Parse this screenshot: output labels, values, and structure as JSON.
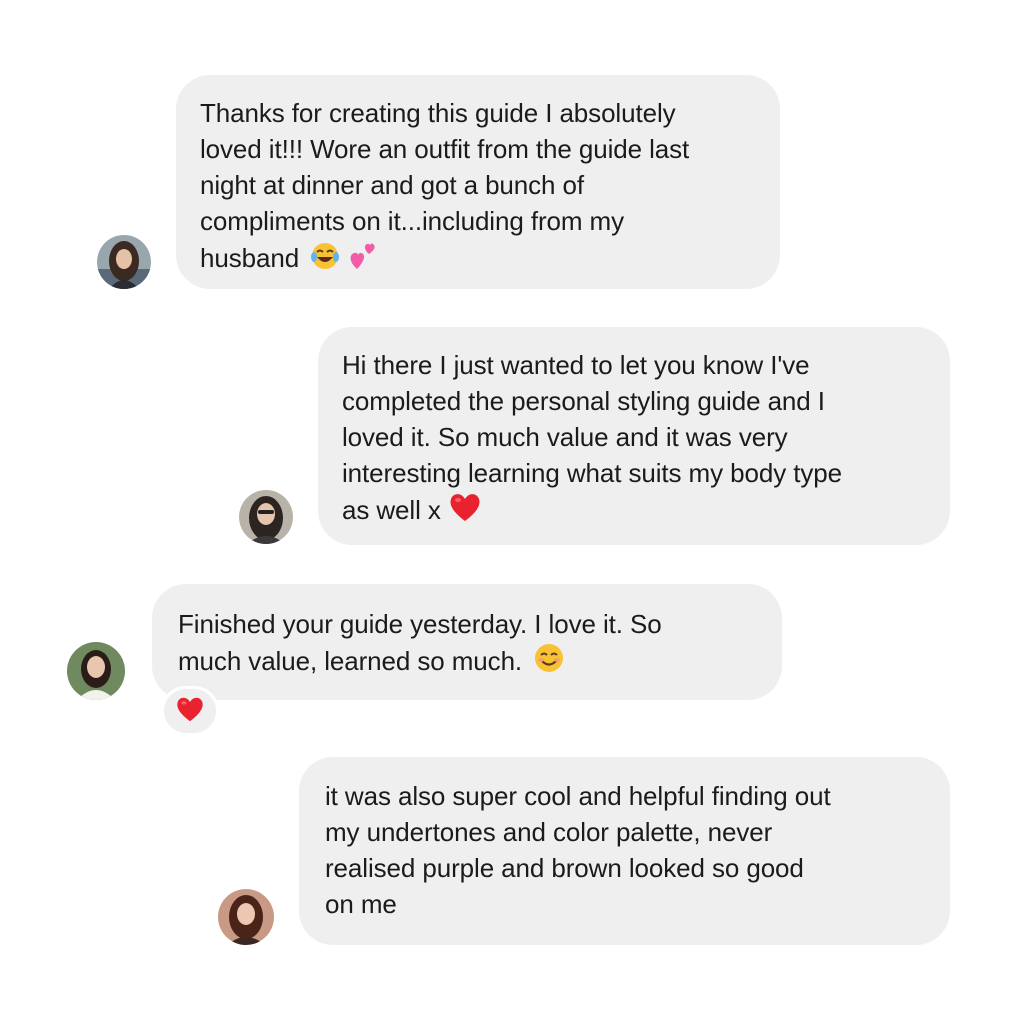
{
  "messages": [
    {
      "text": "Thanks for creating this guide I absolutely\nloved it!!! Wore an outfit from the guide last\nnight at dinner and got a bunch of\ncompliments on it...including from my\nhusband",
      "emoji": [
        "laughing-tears-emoji",
        "two-hearts-emoji"
      ]
    },
    {
      "text": "Hi there I just wanted to let you know I've\ncompleted the personal styling guide and I\nloved it. So much value and it was very\ninteresting learning what suits my body type\nas well x",
      "emoji": [
        "red-heart-emoji"
      ]
    },
    {
      "text": "Finished your guide yesterday. I love it. So\nmuch value, learned so much.",
      "emoji": [
        "smiling-face-emoji"
      ],
      "reaction": "red-heart-emoji"
    },
    {
      "text": "it was also super cool and helpful finding out\nmy undertones and color palette, never\nrealised purple and brown looked so good\non me",
      "emoji": []
    }
  ],
  "colors": {
    "bubble": "#efefef",
    "text": "#1b1b1b",
    "background": "#ffffff",
    "heart": "#e8232f",
    "emoji_yellow": "#f7c233",
    "pink_heart": "#f25ca8"
  }
}
